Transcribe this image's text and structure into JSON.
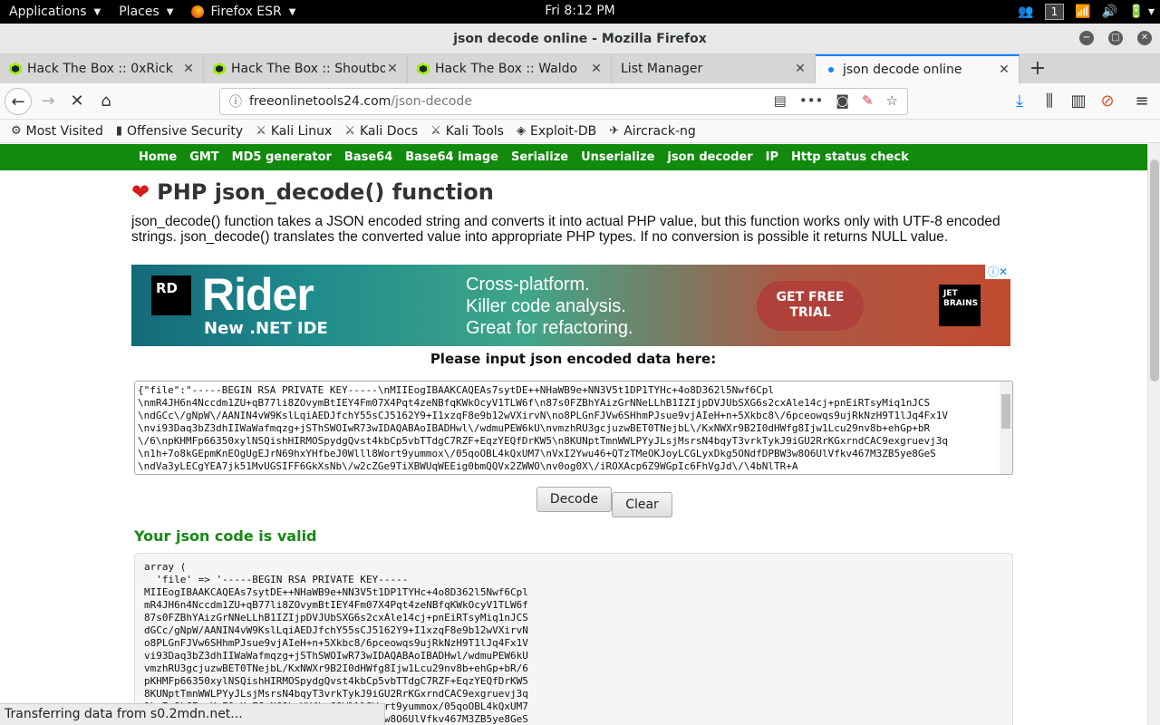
{
  "system": {
    "applications": "Applications",
    "places": "Places",
    "app": "Firefox ESR",
    "clock": "Fri  8:12 PM",
    "workspace": "1"
  },
  "window": {
    "title": "json decode online - Mozilla Firefox"
  },
  "tabs": [
    {
      "label": "Hack The Box :: 0xRick"
    },
    {
      "label": "Hack The Box :: Shoutbox"
    },
    {
      "label": "Hack The Box :: Waldo"
    },
    {
      "label": "List Manager"
    },
    {
      "label": "json decode online"
    }
  ],
  "url": {
    "domain": "freeonlinetools24.com",
    "path": "/json-decode"
  },
  "bookmarks": [
    "Most Visited",
    "Offensive Security",
    "Kali Linux",
    "Kali Docs",
    "Kali Tools",
    "Exploit-DB",
    "Aircrack-ng"
  ],
  "sitenav": [
    "Home",
    "GMT",
    "MD5 generator",
    "Base64",
    "Base64 image",
    "Serialize",
    "Unserialize",
    "json decoder",
    "IP",
    "Http status check"
  ],
  "page": {
    "heading": "PHP json_decode() function",
    "intro": "json_decode() function takes a JSON encoded string and converts it into actual PHP value, but this function works only with UTF-8 encoded strings. json_decode() translates the converted value into appropriate PHP types. If no conversion is possible it returns NULL value.",
    "prompt": "Please input json encoded data here:",
    "input_value": "{\"file\":\"-----BEGIN RSA PRIVATE KEY-----\\nMIIEogIBAAKCAQEAs7sytDE++NHaWB9e+NN3V5t1DP1TYHc+4o8D362l5Nwf6Cpl\n\\nmR4JH6n4Nccdm1ZU+qB77li8ZOvymBtIEY4Fm07X4Pqt4zeNBfqKWkOcyV1TLW6f\\n87s0FZBhYAizGrNNeLLhB1IZIjpDVJUbSXG6s2cxAle14cj+pnEiRTsyMiq1nJCS\n\\ndGCc\\/gNpW\\/AANIN4vW9KslLqiAEDJfchY55sCJ5162Y9+I1xzqF8e9b12wVXirvN\\no8PLGnFJVw6SHhmPJsue9vjAIeH+n+5Xkbc8\\/6pceowqs9ujRkNzH9T1lJq4Fx1V\n\\nvi93Daq3bZ3dhIIWaWafmqzg+jSThSWOIwR73wIDAQABAoIBADHwl\\/wdmuPEW6kU\\nvmzhRU3gcjuzwBET0TNejbL\\/KxNWXr9B2I0dHWfg8Ijw1Lcu29nv8b+ehGp+bR\n\\/6\\npKHMFp66350xylNSQishHIRMOSpydgQvst4kbCp5vbTTdgC7RZF+EqzYEQfDrKW5\\n8KUNptTmnWWLPYyJLsjMsrsN4bqyT3vrkTykJ9iGU2RrKGxrndCAC9exgruevj3q\n\\n1h+7o8kGEpmKnEOgUgEJrN69hxYHfbeJ0Wlll8Wort9yummox\\/05qoOBL4kQxUM7\\nVxI2Ywu46+QTzTMeOKJoyLCGLyxDkg5ONdfDPBW3w8O6UlVfkv467M3ZB5ye8GeS\n\\ndVa3yLECgYEA7jk51MvUGSIFF6GkXsNb\\/w2cZGe9TiXBWUqWEEig0bmQQVx2ZWWO\\nv0og0X\\/iROXAcp6Z9WGpIc6FhVgJd\\/\\4bNlTR+A",
    "decode_label": "Decode",
    "clear_label": "Clear",
    "valid_message": "Your json code is valid",
    "output": "array (\n  'file' => '-----BEGIN RSA PRIVATE KEY-----\nMIIEogIBAAKCAQEAs7sytDE++NHaWB9e+NN3V5t1DP1TYHc+4o8D362l5Nwf6Cpl\nmR4JH6n4Nccdm1ZU+qB77li8ZOvymBtIEY4Fm07X4Pqt4zeNBfqKWkOcyV1TLW6f\n87s0FZBhYAizGrNNeLLhB1IZIjpDVJUbSXG6s2cxAle14cj+pnEiRTsyMiq1nJCS\ndGCc/gNpW/AANIN4vW9KslLqiAEDJfchY55sCJ5162Y9+I1xzqF8e9b12wVXirvN\no8PLGnFJVw6SHhmPJsue9vjAIeH+n+5Xkbc8/6pceowqs9ujRkNzH9T1lJq4Fx1V\nvi93Daq3bZ3dhIIWaWafmqzg+jSThSWOIwR73wIDAQABAoIBADHwl/wdmuPEW6kU\nvmzhRU3gcjuzwBET0TNejbL/KxNWXr9B2I0dHWfg8Ijw1Lcu29nv8b+ehGp+bR/6\npKHMFp66350xylNSQishHIRMOSpydgQvst4kbCp5vbTTdgC7RZF+EqzYEQfDrKW5\n8KUNptTmnWWLPYyJLsjMsrsN4bqyT3vrkTykJ9iGU2RrKGxrndCAC9exgruevj3q\n1h+7o8kGEpmKnEOgUgEJrN69hxYHfbeJ0Wlll8Wort9yummox/05qoOBL4kQxUM7\nVxI2Ywu46+QTzTMeOKJoyLCGLyxDkg5ONdfDPBW3w8O6UlVfkv467M3ZB5ye8GeS"
  },
  "ad": {
    "logo": "RD",
    "product": "Rider",
    "tagline": "New .NET IDE",
    "line1": "Cross-platform.",
    "line2": "Killer code analysis.",
    "line3": "Great for refactoring.",
    "cta": "GET FREE TRIAL",
    "brand": "JET BRAINS"
  },
  "status": "Transferring data from s0.2mdn.net...",
  "colors": {
    "site_nav": "#118a0e",
    "valid_text": "#148a13",
    "tab_accent": "#0a84ff"
  }
}
